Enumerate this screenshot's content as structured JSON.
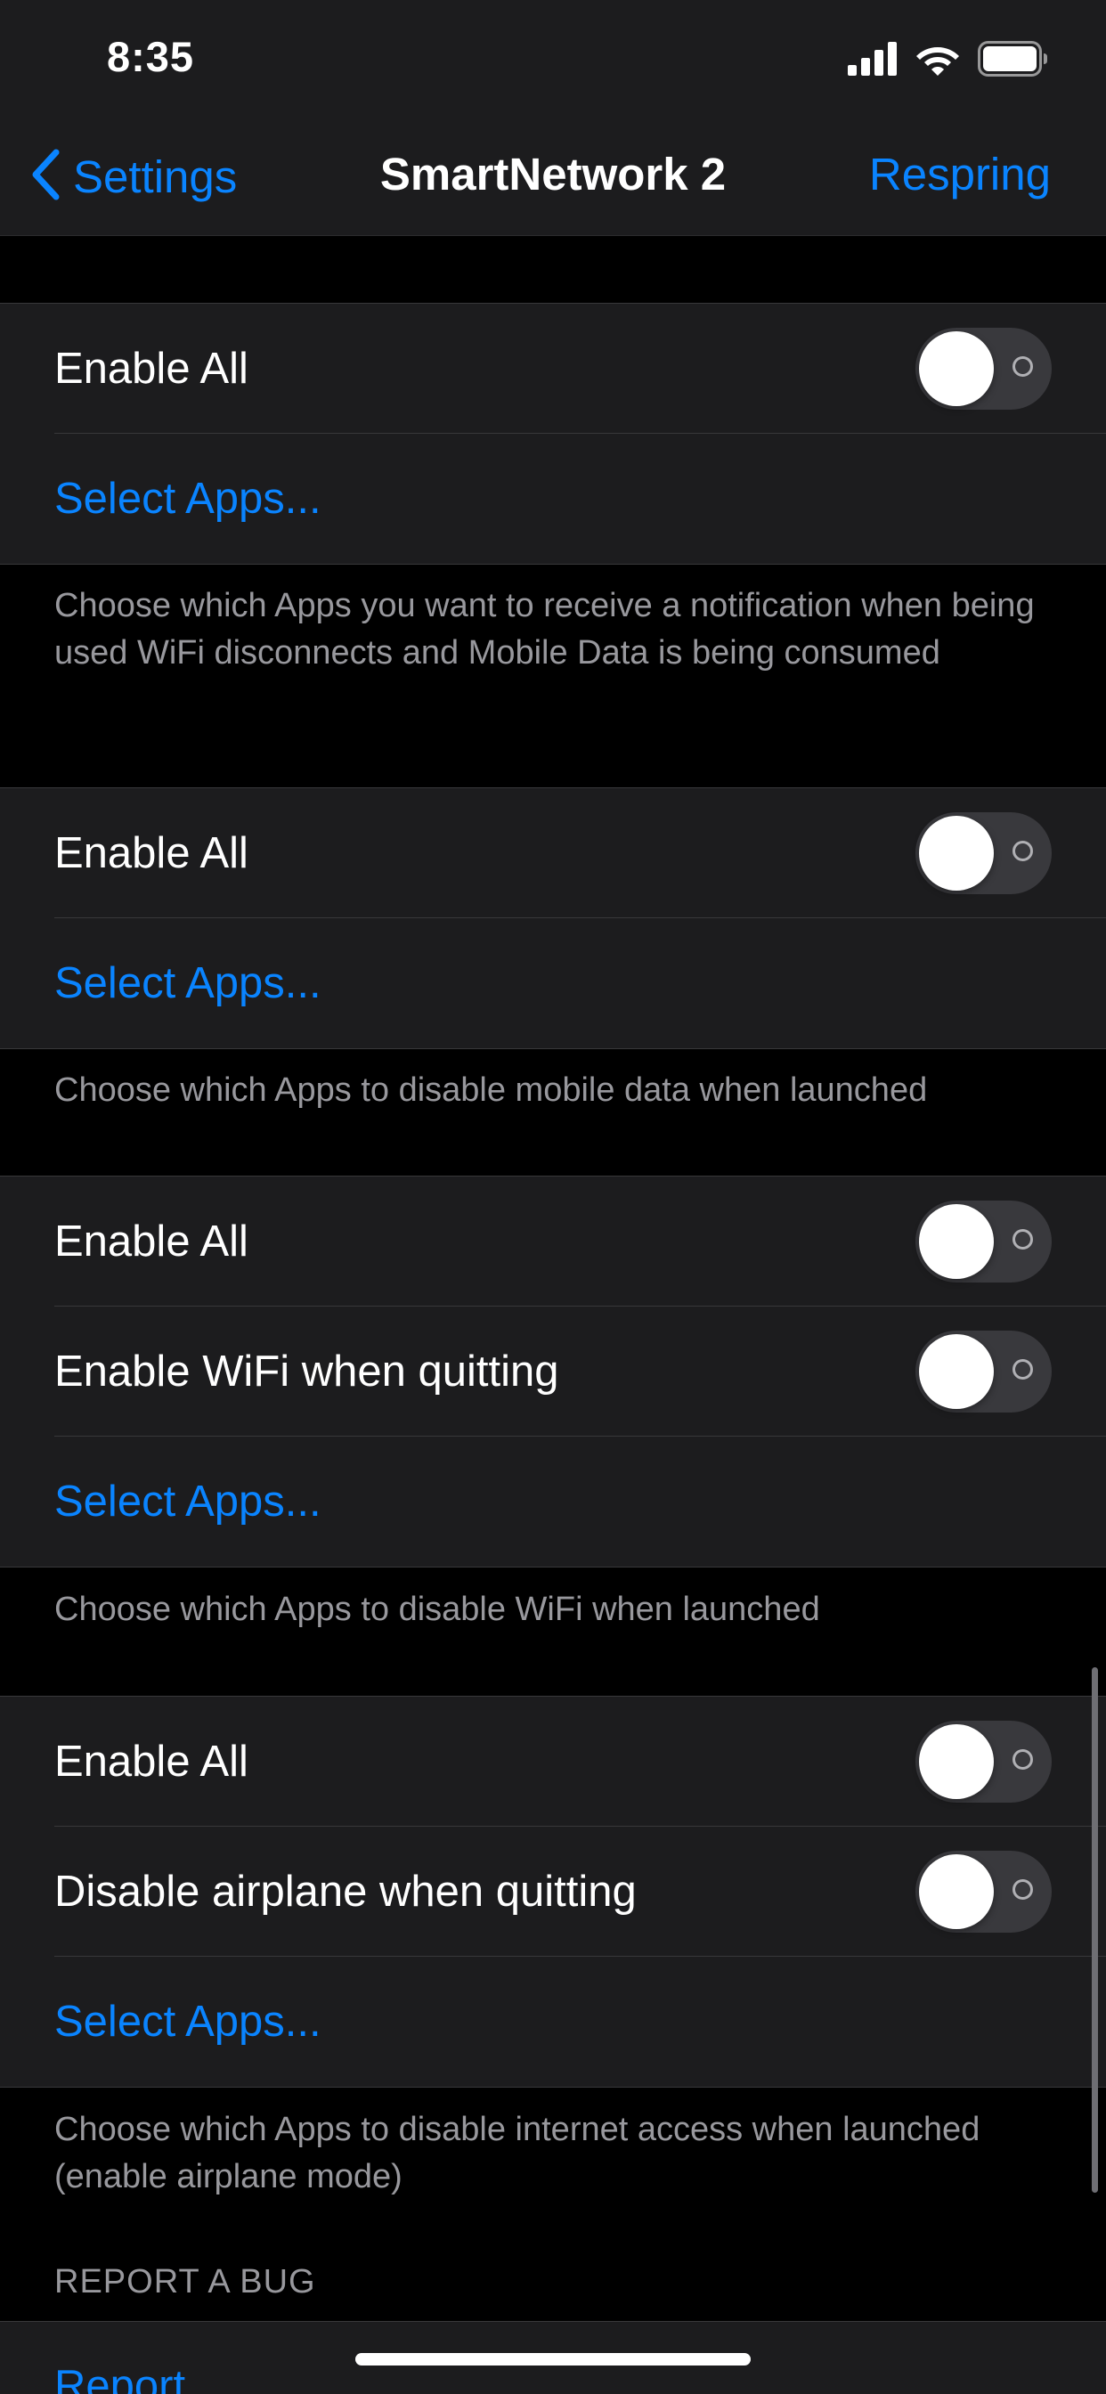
{
  "status_bar": {
    "time": "8:35"
  },
  "nav": {
    "back_label": "Settings",
    "title": "SmartNetwork 2",
    "right_label": "Respring"
  },
  "groups": [
    {
      "rows": [
        {
          "label": "Enable All",
          "toggle_on": false
        },
        {
          "link": "Select Apps..."
        }
      ],
      "footer": "Choose which Apps you want to receive a notification when being used WiFi disconnects and Mobile Data is being consumed"
    },
    {
      "rows": [
        {
          "label": "Enable All",
          "toggle_on": false
        },
        {
          "link": "Select Apps..."
        }
      ],
      "footer": "Choose which Apps to disable mobile data when launched"
    },
    {
      "rows": [
        {
          "label": "Enable All",
          "toggle_on": false
        },
        {
          "label": "Enable WiFi when quitting",
          "toggle_on": false
        },
        {
          "link": "Select Apps..."
        }
      ],
      "footer": "Choose which Apps to disable WiFi when launched"
    },
    {
      "rows": [
        {
          "label": "Enable All",
          "toggle_on": false
        },
        {
          "label": "Disable airplane when quitting",
          "toggle_on": false
        },
        {
          "link": "Select Apps..."
        }
      ],
      "footer": "Choose which Apps to disable internet access when launched (enable airplane mode)"
    }
  ],
  "report_section": {
    "header": "REPORT A BUG",
    "link": "Report"
  },
  "colors": {
    "accent": "#0a84ff",
    "background": "#000000",
    "cell": "#1c1c1e",
    "toggle_off_track": "#39393d",
    "secondary_text": "#98989d"
  },
  "icons": {
    "back": "chevron-left-icon",
    "signal": "cellular-signal-icon",
    "wifi": "wifi-icon",
    "battery": "battery-icon"
  }
}
